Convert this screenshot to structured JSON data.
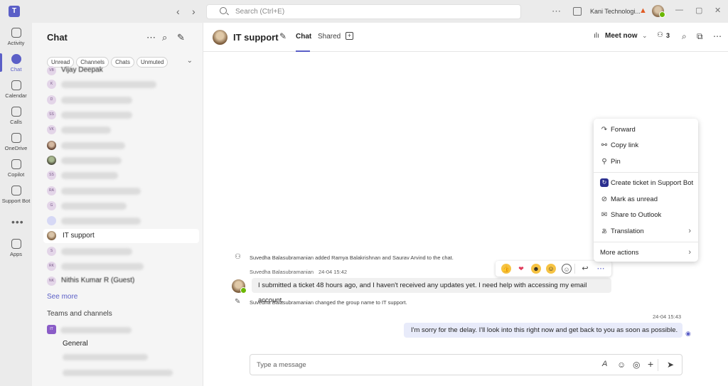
{
  "titlebar": {
    "logo": "T",
    "search_placeholder": "Search (Ctrl+E)",
    "org_name": "Kani Technologi...",
    "back_icon": "chevron-left",
    "forward_icon": "chevron-right",
    "more_icon": "ellipsis",
    "warning_icon": "▲",
    "minimize": "—",
    "maximize": "▢",
    "close": "✕"
  },
  "rail": {
    "items": [
      {
        "label": "Activity",
        "icon": "bell-icon"
      },
      {
        "label": "Chat",
        "icon": "chat-icon",
        "active": true
      },
      {
        "label": "Calendar",
        "icon": "calendar-icon"
      },
      {
        "label": "Calls",
        "icon": "phone-icon"
      },
      {
        "label": "OneDrive",
        "icon": "cloud-icon"
      },
      {
        "label": "Copilot",
        "icon": "copilot-icon"
      },
      {
        "label": "Support Bot",
        "icon": "bot-icon"
      },
      {
        "label": "Apps",
        "icon": "apps-icon"
      }
    ],
    "more": "•••"
  },
  "chatlist": {
    "title": "Chat",
    "more_icon": "⋯",
    "search_icon": "⌕",
    "compose_icon": "✎",
    "filters": [
      "Unread",
      "Channels",
      "Chats",
      "Unmuted"
    ],
    "filter_chevron": "⌄",
    "items": [
      {
        "initials": "VB",
        "name": "Vijay Deepak"
      },
      {
        "initials": "K",
        "name": ""
      },
      {
        "initials": "D",
        "name": ""
      },
      {
        "initials": "SS",
        "name": ""
      },
      {
        "initials": "VK",
        "name": ""
      },
      {
        "initials": "",
        "name": ""
      },
      {
        "initials": "",
        "name": ""
      },
      {
        "initials": "SS",
        "name": ""
      },
      {
        "initials": "RA",
        "name": ""
      },
      {
        "initials": "G",
        "name": ""
      },
      {
        "initials": "",
        "name": ""
      },
      {
        "initials": "",
        "name": "IT support",
        "selected": true
      },
      {
        "initials": "S",
        "name": ""
      },
      {
        "initials": "RK",
        "name": ""
      },
      {
        "initials": "NK",
        "name": "Nithis Kumar R (Guest)"
      }
    ],
    "see_more": "See more",
    "teams_header": "Teams and channels",
    "team_initials": "IT",
    "channel": "General"
  },
  "header": {
    "title": "IT support",
    "edit_icon": "✎",
    "tabs": [
      "Chat",
      "Shared"
    ],
    "add_tab": "+",
    "meet_now": "Meet now",
    "meet_chevron": "⌄",
    "people_count": "3",
    "search_icon": "⌕",
    "popout_icon": "⧉",
    "more_icon": "⋯"
  },
  "messages": {
    "system_add": "Suvedha Balasubramanian added Ramya Balakrishnan and Saurav Arvind to the chat.",
    "incoming_sender": "Suvedha Balasubramanian",
    "incoming_time": "24-04 15:42",
    "incoming_text": "I submitted a ticket 48 hours ago, and I haven't received any updates yet. I need help with accessing my email account.",
    "system_rename": "Suvedha Balasubramanian changed the group name to IT support.",
    "outgoing_time": "24-04 15:43",
    "outgoing_text": "I'm sorry for the delay. I'll look into this right now and get back to you as soon as possible."
  },
  "reactions": [
    "👍",
    "❤️",
    "😆",
    "😮",
    "☺",
    "↩",
    "⋯"
  ],
  "context_menu": {
    "items": [
      {
        "label": "Forward",
        "icon": "forward-icon",
        "glyph": "↷"
      },
      {
        "label": "Copy link",
        "icon": "link-icon",
        "glyph": "⚯"
      },
      {
        "label": "Pin",
        "icon": "pin-icon",
        "glyph": "⚲"
      },
      {
        "label": "Create ticket in Support Bot",
        "icon": "support-bot-icon",
        "glyph": "↻"
      },
      {
        "label": "Mark as unread",
        "icon": "unread-icon",
        "glyph": "⊘"
      },
      {
        "label": "Share to Outlook",
        "icon": "mail-icon",
        "glyph": "✉"
      },
      {
        "label": "Translation",
        "icon": "translate-icon",
        "glyph": "あ"
      },
      {
        "label": "More actions",
        "icon": "",
        "glyph": ""
      }
    ],
    "chevron": "›"
  },
  "composer": {
    "placeholder": "Type a message",
    "format_icon": "A",
    "emoji_icon": "☺",
    "sticker_icon": "◎",
    "attach_icon": "+",
    "send_icon": "➤"
  },
  "colors": {
    "accent": "#5b5fc7",
    "presence": "#6bb700",
    "outgoing_bubble": "#e8ebfa"
  }
}
